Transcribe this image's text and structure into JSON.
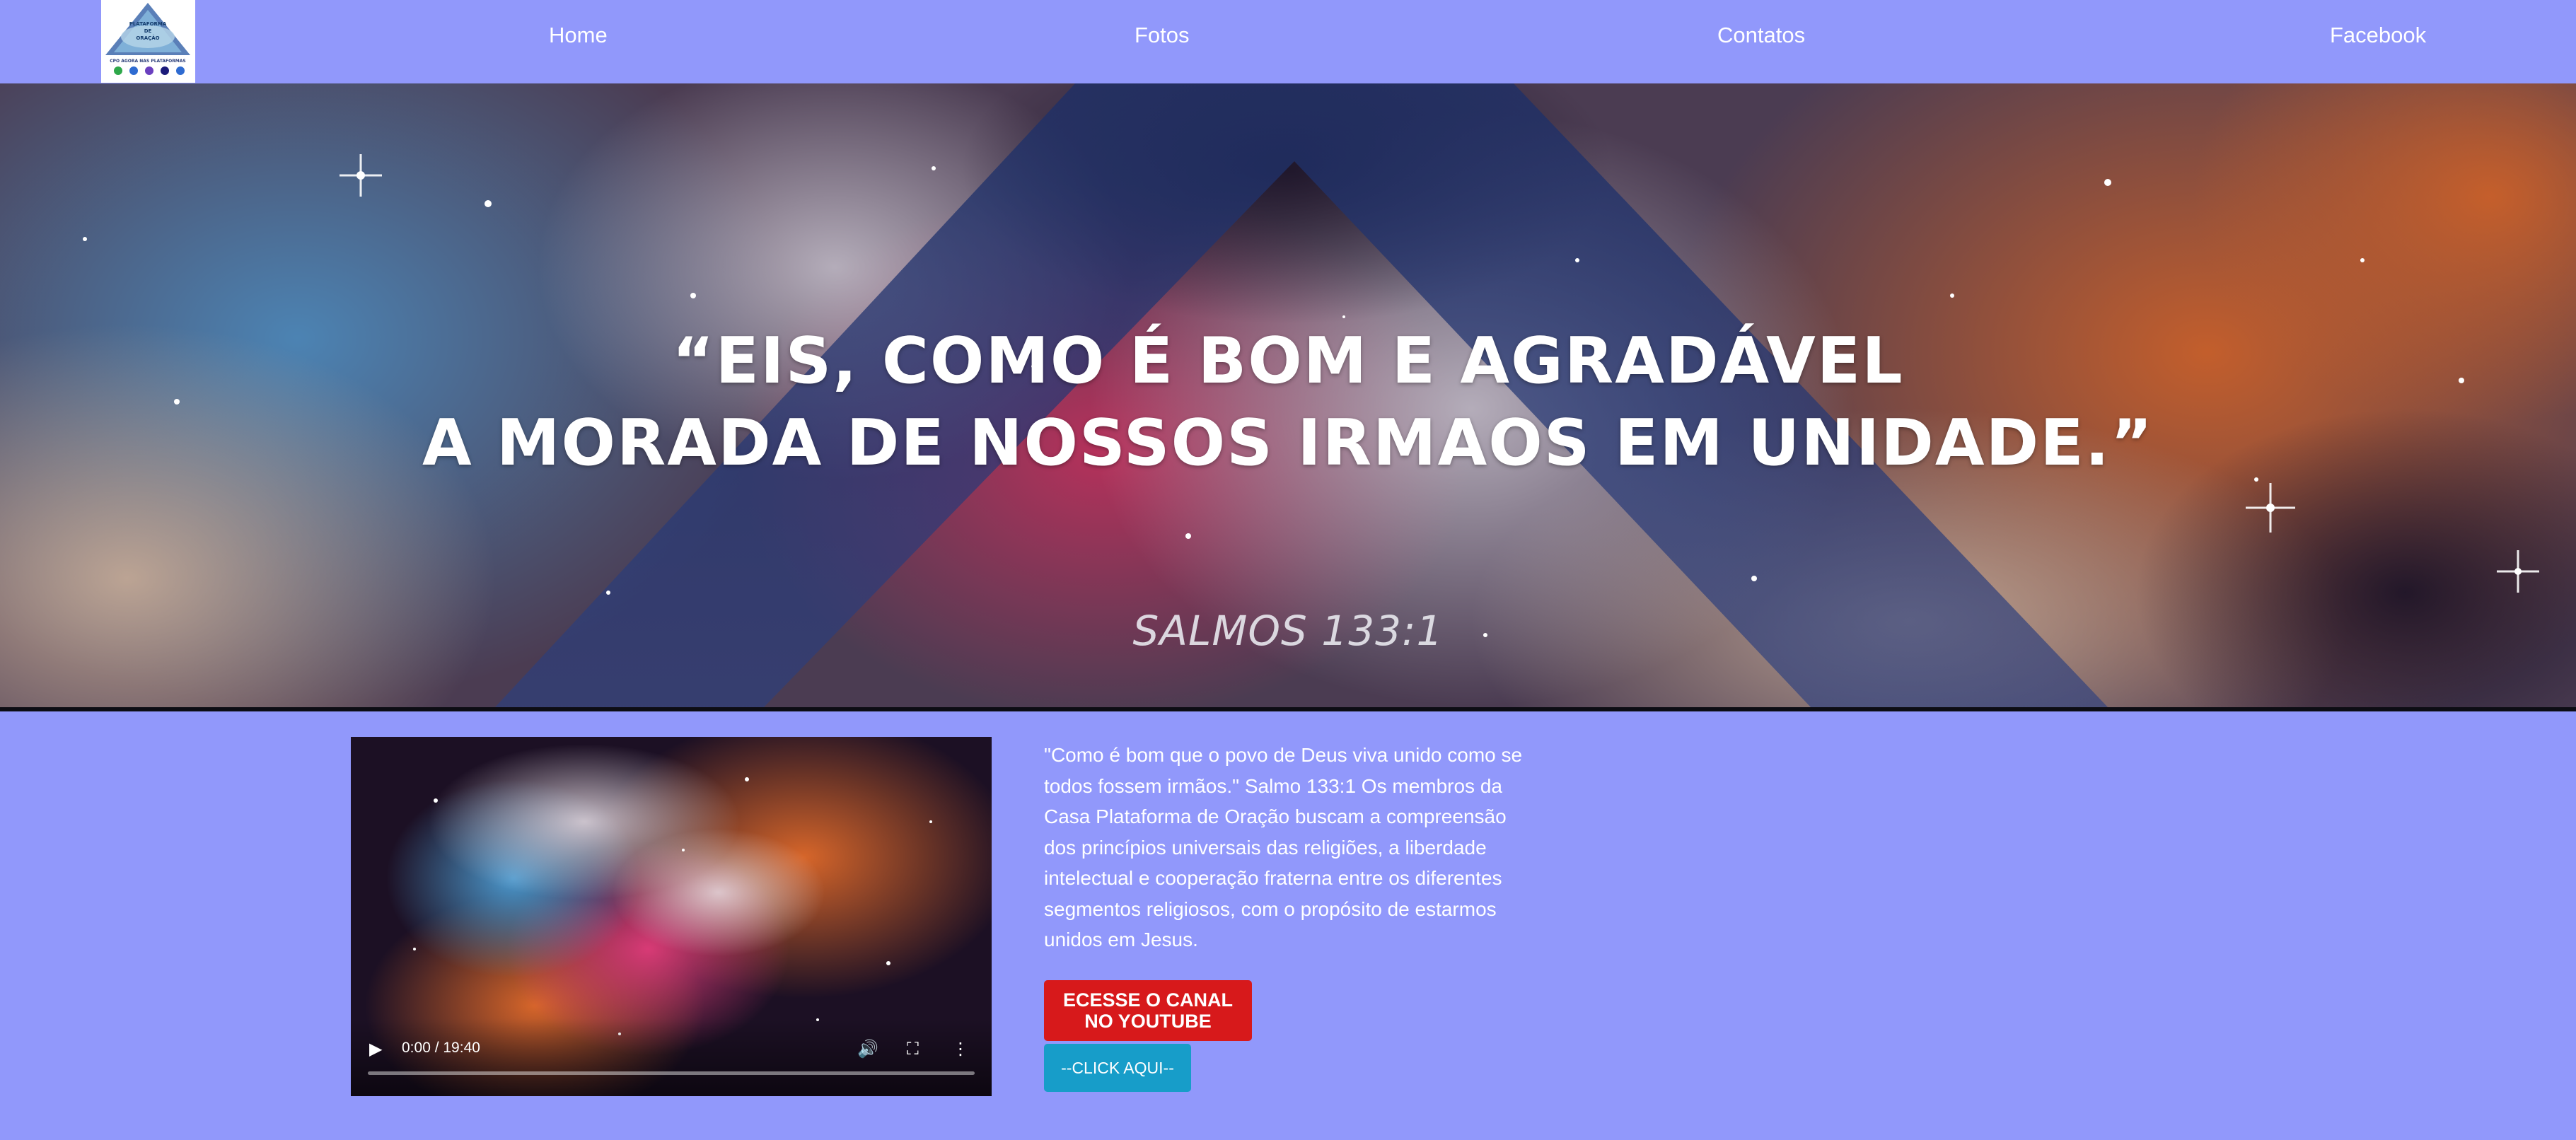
{
  "nav": {
    "logo": {
      "title_line1": "PLATAFORMA",
      "title_line2": "DE",
      "title_line3": "ORAÇÃO",
      "tagline": "CPO AGORA NAS PLATAFORMAS"
    },
    "links": [
      {
        "label": "Home"
      },
      {
        "label": "Fotos"
      },
      {
        "label": "Contatos"
      },
      {
        "label": "Facebook"
      }
    ]
  },
  "hero": {
    "quote_line1": "“EIS, COMO É BOM E AGRADÁVEL",
    "quote_line2": "A MORADA DE NOSSOS IRMAOS EM UNIDADE.”",
    "reference": "SALMOS 133:1"
  },
  "video": {
    "time": "0:00 / 19:40",
    "progress": 0
  },
  "content": {
    "description": "\"Como é bom que o povo de Deus viva unido como se todos fossem irmãos.\" Salmo 133:1 Os membros da Casa Plataforma de Oração buscam a compreensão dos princípios universais das religiões, a liberdade intelectual e cooperação fraterna entre os diferentes segmentos religiosos, com o propósito de estarmos unidos em Jesus.",
    "youtube_button": "ECESSE O CANAL NO YOUTUBE",
    "click_button": "--CLICK AQUI--"
  },
  "colors": {
    "page_background": "#9198fb",
    "youtube_button": "#d7191b",
    "click_button": "#179dc9",
    "text": "#ffffff"
  }
}
